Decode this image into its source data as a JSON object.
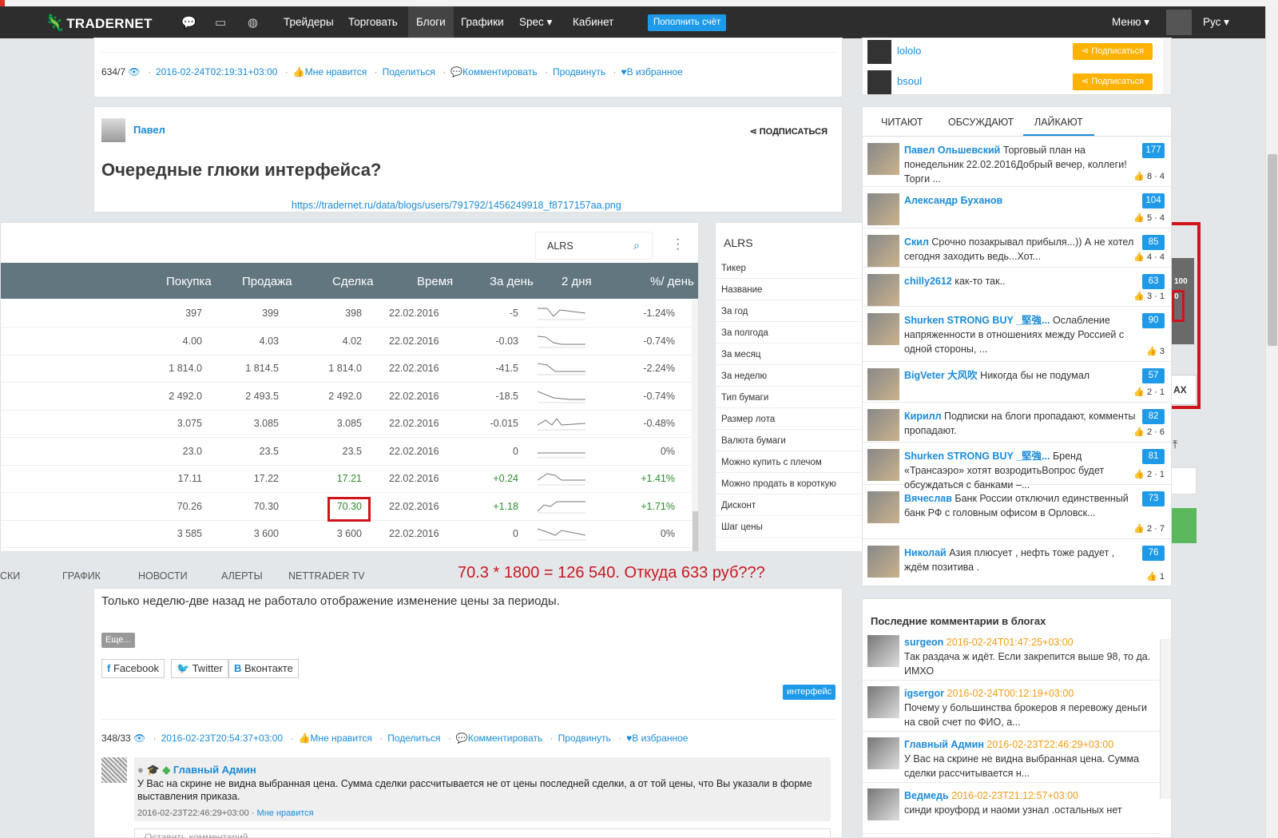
{
  "nav": {
    "logo": "TRADERNET",
    "items": [
      "Трейдеры",
      "Торговать",
      "Блоги",
      "Графики",
      "Spec ▾",
      "Кабинет"
    ],
    "deposit": "Пополнить счёт",
    "menu": "Меню ▾",
    "lang": "Рус ▾"
  },
  "post1": {
    "count": "634/7",
    "date": "2016-02-24T02:19:31+03:00",
    "like": "Мне нравится",
    "share": "Поделиться",
    "comment": "Комментировать",
    "promote": "Продвинуть",
    "fav": "В избранное"
  },
  "post2": {
    "author": "Павел",
    "subscribe": "ПОДПИСАТЬСЯ",
    "title": "Очередные глюки интерфейса?",
    "url": "https://tradernet.ru/data/blogs/users/791792/1456249918_f8717157aa.png"
  },
  "quotes": {
    "search": "ALRS",
    "headers": [
      "Покупка",
      "Продажа",
      "Сделка",
      "Время",
      "За день",
      "2 дня",
      "%/ день"
    ],
    "rows": [
      [
        "397",
        "399",
        "398",
        "22.02.2016",
        "-5",
        "-1.24%"
      ],
      [
        "4.00",
        "4.03",
        "4.02",
        "22.02.2016",
        "-0.03",
        "-0.74%"
      ],
      [
        "1 814.0",
        "1 814.5",
        "1 814.0",
        "22.02.2016",
        "-41.5",
        "-2.24%"
      ],
      [
        "2 492.0",
        "2 493.5",
        "2 492.0",
        "22.02.2016",
        "-18.5",
        "-0.74%"
      ],
      [
        "3.075",
        "3.085",
        "3.085",
        "22.02.2016",
        "-0.015",
        "-0.48%"
      ],
      [
        "23.0",
        "23.5",
        "23.5",
        "22.02.2016",
        "0",
        "0%"
      ],
      [
        "17.11",
        "17.22",
        "17.21",
        "22.02.2016",
        "+0.24",
        "+1.41%"
      ],
      [
        "70.26",
        "70.30",
        "70.30",
        "22.02.2016",
        "+1.18",
        "+1.71%"
      ],
      [
        "3 585",
        "3 600",
        "3 600",
        "22.02.2016",
        "0",
        "0%"
      ]
    ],
    "tabs": [
      "СКИ",
      "ГРАФИК",
      "НОВОСТИ",
      "АЛЕРТЫ",
      "NETTRADER TV"
    ],
    "formula": "70.3 * 1800 = 126 540. Откуда 633 руб???"
  },
  "info": {
    "title": "ALRS",
    "fields": [
      "Тикер",
      "Название",
      "За год",
      "За полгода",
      "За месяц",
      "За неделю",
      "Тип бумаги",
      "Размер лота",
      "Валюта бумаги",
      "Можно купить с плечом",
      "Можно продать в короткую",
      "Дисконт",
      "Шаг цены"
    ]
  },
  "overflow": {
    "gray_top": "100",
    "gray_mid": "0",
    "max": "AX"
  },
  "post3": {
    "text": "Только неделю-две назад не работало отображение изменение цены за периоды.",
    "more": "Еще...",
    "share_fb": "Facebook",
    "share_tw": "Twitter",
    "share_vk": "Вконтакте",
    "tag": "интерфейс",
    "count": "348/33",
    "date": "2016-02-23T20:54:37+03:00",
    "like": "Мне нравится",
    "share": "Поделиться",
    "comment": "Комментировать",
    "promote": "Продвинуть",
    "fav": "В избранное",
    "c_name": "Главный Админ",
    "c_body": "У Вас на скрине не видна выбранная цена. Сумма сделки рассчитывается не от цены последней сделки, а от той цены, что Вы указали в форме выставления приказа.",
    "c_date": "2016-02-23T22:46:29+03:00",
    "c_like": "Мне нравится",
    "reply_placeholder": "Оставить комментарий..."
  },
  "subs": [
    {
      "name": "lololo",
      "btn": "Подписаться"
    },
    {
      "name": "bsoul",
      "btn": "Подписаться"
    }
  ],
  "popular": {
    "tabs": [
      "ЧИТАЮТ",
      "ОБСУЖДАЮТ",
      "ЛАЙКАЮТ"
    ],
    "items": [
      {
        "name": "Павел Ольшевский",
        "text": "Торговый план на понедельник 22.02.2016Добрый вечер, коллеги! Торги ...",
        "badge": "177",
        "stats": "8 · 4"
      },
      {
        "name": "Александр Буханов",
        "text": "",
        "badge": "104",
        "stats": "5 · 4"
      },
      {
        "name": "Скил",
        "text": "Срочно позакрывал прибыля...)) А не хотел сегодня заходить ведь...Хот...",
        "badge": "85",
        "stats": "4 · 4"
      },
      {
        "name": "chilly2612",
        "text": "как-то так..",
        "badge": "63",
        "stats": "3 · 1"
      },
      {
        "name": "Shurken STRONG BUY _堅強...",
        "text": "Ослабление напряженности в отношениях между Россией с одной стороны, ...",
        "badge": "90",
        "stats": "3"
      },
      {
        "name": "BigVeter 大风吹",
        "text": "Никогда бы не подумал",
        "badge": "57",
        "stats": "2 · 1"
      },
      {
        "name": "Кирилл",
        "text": "Подписки на блоги пропадают, комменты пропадают.",
        "badge": "82",
        "stats": "2 · 6"
      },
      {
        "name": "Shurken STRONG BUY _堅強...",
        "text": "Бренд «Трансаэро» хотят возродитьВопрос будет обсуждаться с банками –...",
        "badge": "81",
        "stats": "2 · 1"
      },
      {
        "name": "Вячеслав",
        "text": "Банк России отключил единственный банк РФ с головным офисом в Орловск...",
        "badge": "73",
        "stats": "2 · 7"
      },
      {
        "name": "Николай",
        "text": "Азия плюсует , нефть тоже радует , ждём позитива .",
        "badge": "76",
        "stats": "1"
      }
    ]
  },
  "lastc": {
    "title": "Последние комментарии в блогах",
    "items": [
      {
        "name": "surgeon",
        "date": "2016-02-24T01:47:25+03:00",
        "text": "Так раздача ж идёт. Если закрепится выше 98, то да. ИМХО"
      },
      {
        "name": "igsergor",
        "date": "2016-02-24T00:12:19+03:00",
        "text": "Почему у большинства брокеров я перевожу деньги на свой счет по ФИО, а..."
      },
      {
        "name": "Главный Админ",
        "date": "2016-02-23T22:46:29+03:00",
        "text": "У Вас на скрине не видна выбранная цена. Сумма сделки рассчитывается н..."
      },
      {
        "name": "Ведмедь",
        "date": "2016-02-23T21:12:57+03:00",
        "text": "синди кроуфорд и наоми узнал .остальных нет"
      }
    ]
  }
}
